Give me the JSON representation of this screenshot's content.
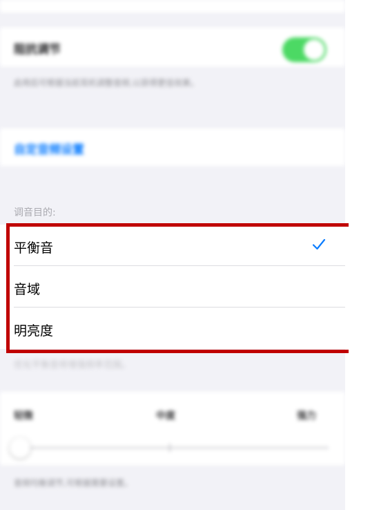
{
  "toggle_section": {
    "label": "阻抗调节",
    "on": true,
    "note": "启用后可根据当前耳机调整音频,以获得更佳效果。"
  },
  "link_label": "自定音频设置",
  "purpose": {
    "header": "调音目的:",
    "options": [
      {
        "label": "平衡音",
        "selected": true
      },
      {
        "label": "音域",
        "selected": false
      },
      {
        "label": "明亮度",
        "selected": false
      }
    ],
    "note": "优化平衡音将增强频率范围。"
  },
  "slider": {
    "labels": [
      "轻微",
      "中度",
      "强力"
    ],
    "note": "音频均衡调节,可根据需要设置。"
  },
  "colors": {
    "accent": "#0a7cff",
    "toggle_on": "#4cd964",
    "highlight": "#c00000"
  },
  "icons": {
    "check": "checkmark-icon"
  }
}
